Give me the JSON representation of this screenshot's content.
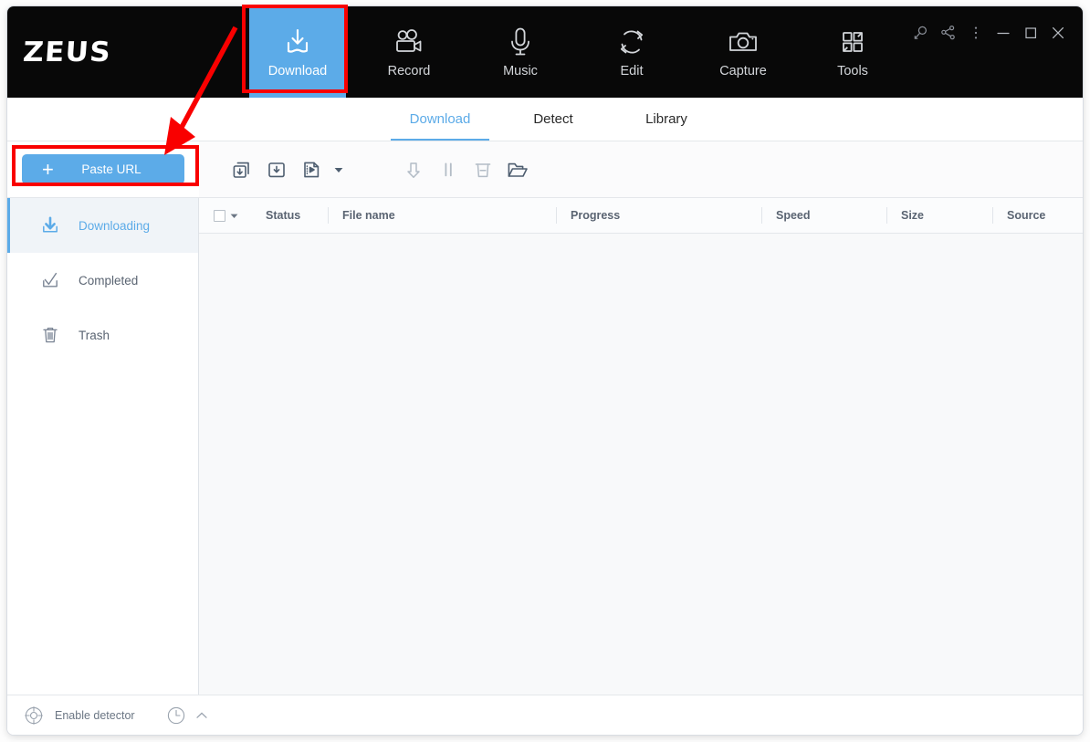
{
  "app": {
    "logo": "ZEUS"
  },
  "topnav": {
    "items": [
      {
        "label": "Download",
        "icon": "download-tray-icon",
        "active": true
      },
      {
        "label": "Record",
        "icon": "video-camera-icon",
        "active": false
      },
      {
        "label": "Music",
        "icon": "microphone-icon",
        "active": false
      },
      {
        "label": "Edit",
        "icon": "refresh-cycle-icon",
        "active": false
      },
      {
        "label": "Capture",
        "icon": "camera-icon",
        "active": false
      },
      {
        "label": "Tools",
        "icon": "grid-squares-icon",
        "active": false
      }
    ],
    "active_color": "#5cabe8",
    "bar_color": "#080808"
  },
  "window_controls": [
    {
      "name": "search-icon",
      "glyph": "search"
    },
    {
      "name": "share-icon",
      "glyph": "share"
    },
    {
      "name": "more-menu-icon",
      "glyph": "dots"
    },
    {
      "name": "minimize-icon",
      "glyph": "minimize"
    },
    {
      "name": "maximize-icon",
      "glyph": "maximize"
    },
    {
      "name": "close-icon",
      "glyph": "close"
    }
  ],
  "subtabs": {
    "items": [
      {
        "label": "Download",
        "active": true
      },
      {
        "label": "Detect",
        "active": false
      },
      {
        "label": "Library",
        "active": false
      }
    ]
  },
  "toolbar": {
    "paste_url_label": "Paste URL",
    "plus_glyph": "+",
    "buttons": [
      {
        "name": "batch-download-icon",
        "title": "Batch download",
        "disabled": false
      },
      {
        "name": "single-download-icon",
        "title": "Add download",
        "disabled": false
      },
      {
        "name": "video-file-icon",
        "title": "Add video file",
        "disabled": false
      },
      {
        "name": "dropdown-caret-icon",
        "title": "More options",
        "disabled": false
      },
      {
        "name": "start-download-icon",
        "title": "Start",
        "disabled": true
      },
      {
        "name": "pause-download-icon",
        "title": "Pause",
        "disabled": true
      },
      {
        "name": "delete-icon",
        "title": "Delete",
        "disabled": true
      },
      {
        "name": "open-folder-icon",
        "title": "Open folder",
        "disabled": false
      }
    ]
  },
  "sidebar": {
    "items": [
      {
        "label": "Downloading",
        "icon": "download-arrow-icon",
        "active": true
      },
      {
        "label": "Completed",
        "icon": "check-tray-icon",
        "active": false
      },
      {
        "label": "Trash",
        "icon": "trash-bin-icon",
        "active": false
      }
    ]
  },
  "table": {
    "columns": [
      {
        "key": "select",
        "label": ""
      },
      {
        "key": "status",
        "label": "Status"
      },
      {
        "key": "filename",
        "label": "File name"
      },
      {
        "key": "progress",
        "label": "Progress"
      },
      {
        "key": "speed",
        "label": "Speed"
      },
      {
        "key": "size",
        "label": "Size"
      },
      {
        "key": "source",
        "label": "Source"
      }
    ],
    "rows": []
  },
  "statusbar": {
    "enable_detector_label": "Enable detector",
    "detector_icon": "target-crosshair-icon",
    "history_icon": "clock-icon",
    "expand_icon": "chevron-up-icon"
  },
  "annotations": {
    "highlight_color": "#f90000",
    "boxes": [
      {
        "name": "download-tab-highlight",
        "target": "Download"
      },
      {
        "name": "paste-url-button-highlight",
        "target": "Paste URL"
      }
    ],
    "arrow": {
      "from": "Download tab",
      "to": "Paste URL button"
    }
  }
}
